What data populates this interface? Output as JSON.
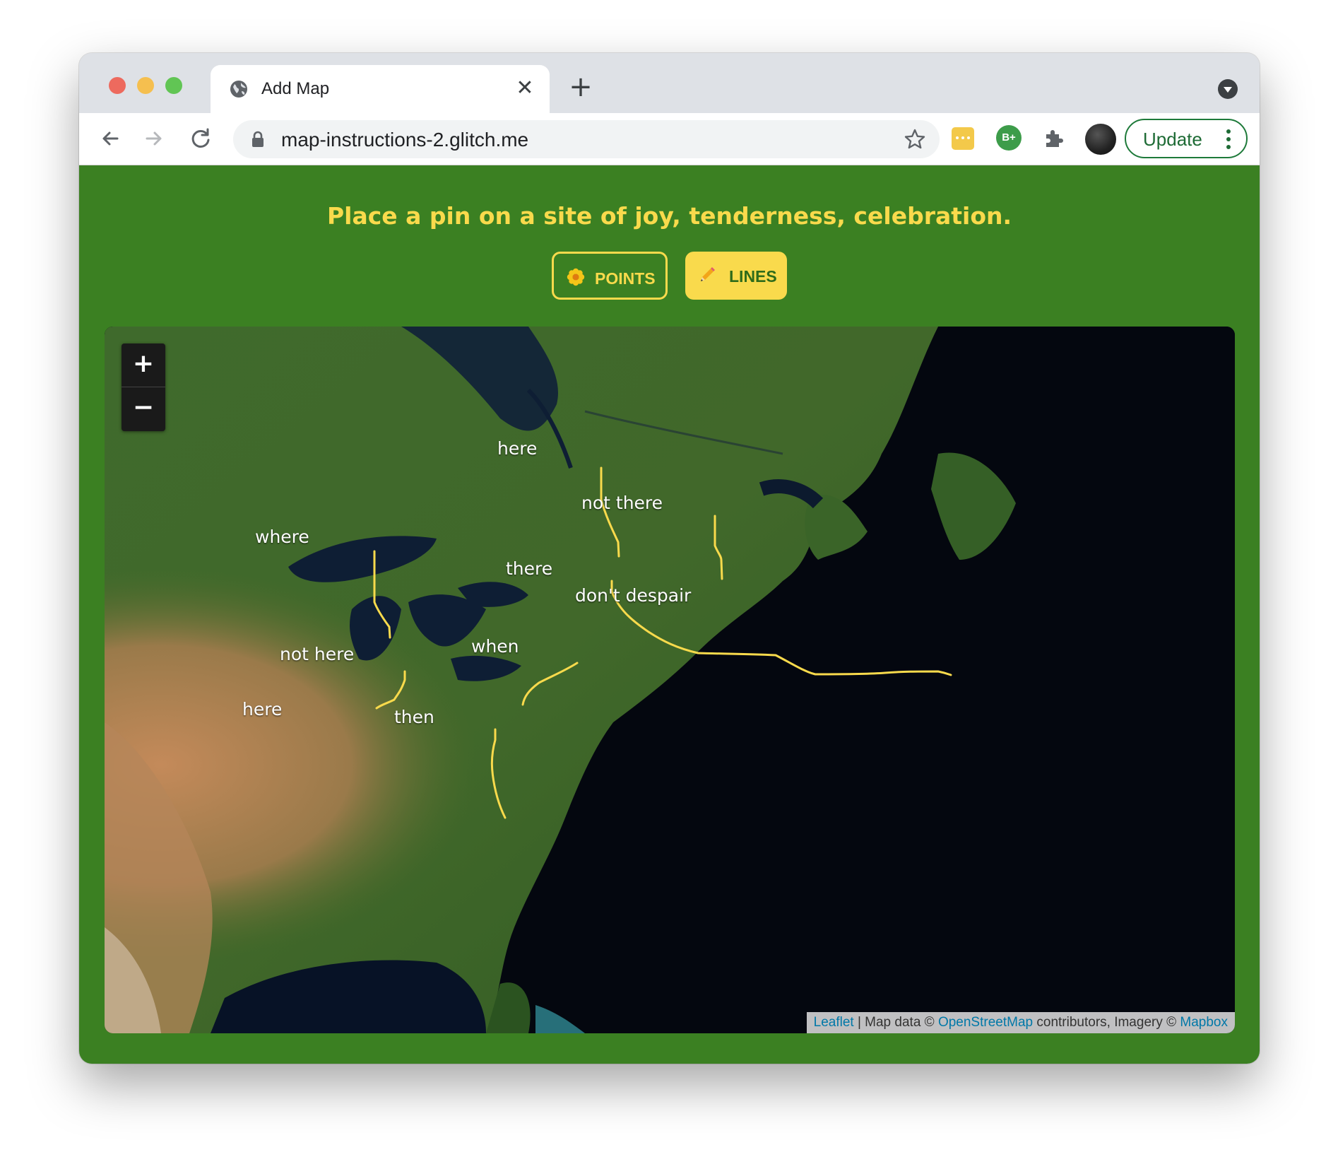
{
  "browser": {
    "tab_title": "Add Map",
    "url": "map-instructions-2.glitch.me",
    "update_label": "Update",
    "extension_badge": "B+"
  },
  "page": {
    "prompt": "Place a pin on a site of joy, tenderness, celebration.",
    "modes": [
      {
        "label": "POINTS",
        "icon": "flower-icon",
        "selected": false
      },
      {
        "label": "LINES",
        "icon": "pencil-icon",
        "selected": true
      }
    ]
  },
  "map": {
    "zoom_in_label": "+",
    "zoom_out_label": "−",
    "line_color": "#f9da4c",
    "labels": [
      "here",
      "not there",
      "where",
      "there",
      "don't despair",
      "when",
      "not here",
      "here",
      "then"
    ],
    "attribution": {
      "leaflet": "Leaflet",
      "sep1": " | Map data © ",
      "osm": "OpenStreetMap",
      "mid": " contributors, Imagery © ",
      "mapbox": "Mapbox"
    }
  },
  "colors": {
    "page_background": "#3b8022",
    "accent_yellow": "#f9da4c",
    "update_green": "#1e6b35"
  }
}
